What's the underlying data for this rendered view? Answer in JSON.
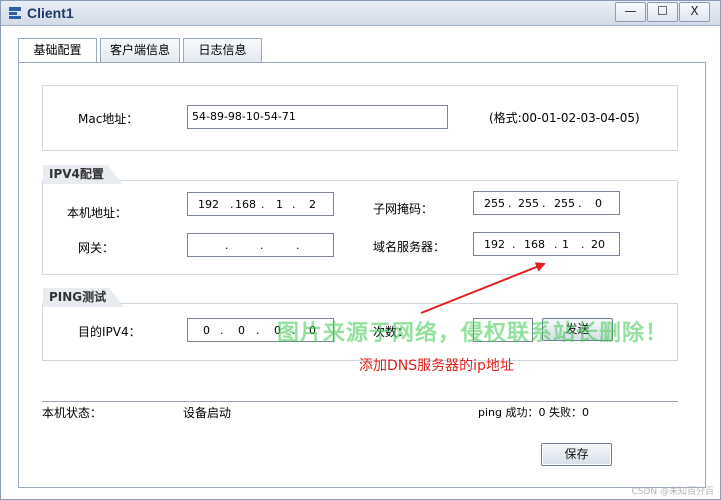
{
  "window": {
    "title": "Client1",
    "minimize_glyph": "—",
    "maximize_glyph": "☐",
    "close_glyph": "X"
  },
  "tabs": [
    {
      "label": "基础配置",
      "active": true
    },
    {
      "label": "客户端信息",
      "active": false
    },
    {
      "label": "日志信息",
      "active": false
    }
  ],
  "mac": {
    "label": "Mac地址：",
    "value": "54-89-98-10-54-71",
    "format_hint": "(格式:00-01-02-03-04-05)"
  },
  "ipv4": {
    "legend": "IPV4配置",
    "host_ip_label": "本机地址：",
    "host_ip": [
      "192",
      "168",
      "1",
      "2"
    ],
    "subnet_label": "子网掩码：",
    "subnet": [
      "255",
      "255",
      "255",
      "0"
    ],
    "gateway_label": "网关：",
    "gateway": [
      "",
      "",
      "",
      ""
    ],
    "dns_label": "域名服务器：",
    "dns": [
      "192",
      "168",
      "1",
      "20"
    ]
  },
  "ping": {
    "legend": "PING测试",
    "target_label": "目的IPV4：",
    "target": [
      "0",
      "0",
      "0",
      "0"
    ],
    "count_label": "次数：",
    "count_value": "",
    "send_label": "发送"
  },
  "status": {
    "label": "本机状态：",
    "value": "设备启动",
    "ping_result": "ping 成功：0 失败：0"
  },
  "save_label": "保存",
  "annotation": "添加DNS服务器的ip地址",
  "watermark": "图片来源于网络，侵权联系站长删除！",
  "csdn_mark": "CSDN @未知百分百",
  "colors": {
    "annotation": "#e0201b",
    "watermark": "#3cc850",
    "title": "#1f3a66"
  }
}
